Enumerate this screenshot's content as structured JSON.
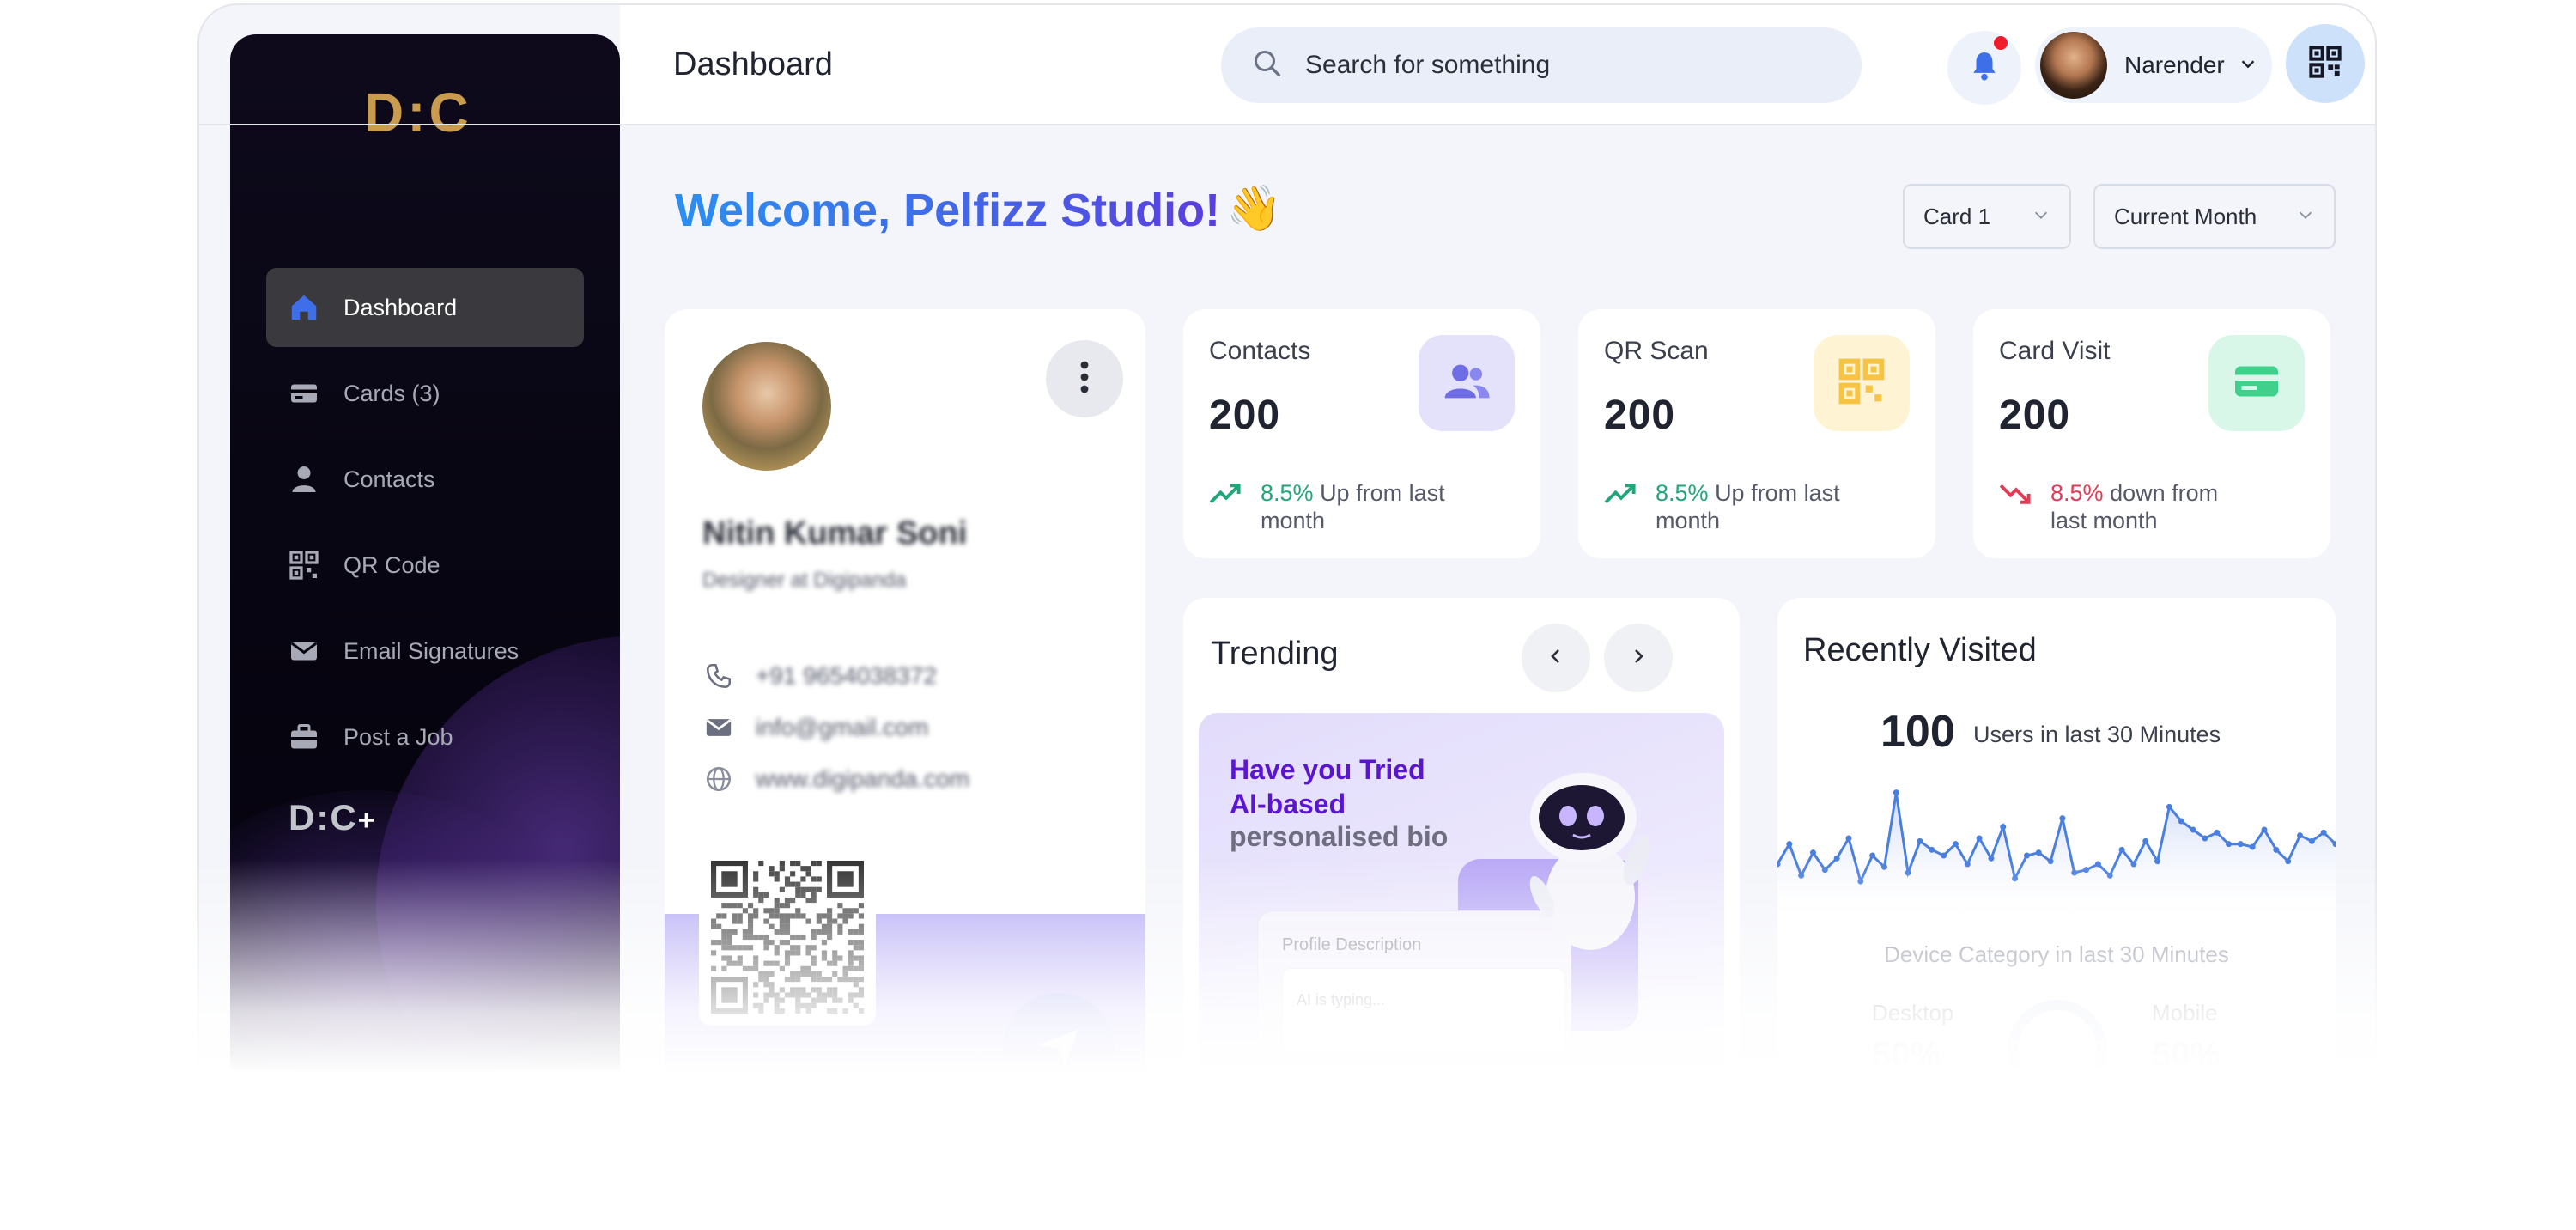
{
  "sidebar": {
    "logo": "D:C",
    "items": [
      {
        "label": "Dashboard",
        "icon": "home-icon",
        "active": true
      },
      {
        "label": "Cards (3)",
        "icon": "card-icon"
      },
      {
        "label": "Contacts",
        "icon": "person-icon"
      },
      {
        "label": "QR Code",
        "icon": "qr-icon"
      },
      {
        "label": "Email Signatures",
        "icon": "mail-icon"
      },
      {
        "label": "Post a Job",
        "icon": "briefcase-icon"
      }
    ],
    "footer_logo": "D:C"
  },
  "header": {
    "title": "Dashboard",
    "search_placeholder": "Search for something",
    "user_name": "Narender"
  },
  "welcome": {
    "text": "Welcome, Pelfizz Studio!",
    "emoji": "👋"
  },
  "filters": {
    "card": "Card 1",
    "period": "Current Month"
  },
  "profile": {
    "name": "Nitin Kumar Soni",
    "role": "Designer at Digipanda",
    "phone": "+91 9654038372",
    "email": "info@gmail.com",
    "website": "www.digipanda.com"
  },
  "stats": [
    {
      "label": "Contacts",
      "value": "200",
      "change": "8.5%",
      "direction": "up",
      "note": "Up from last month",
      "icon": "people-icon",
      "bg": "#e4e1fb",
      "color": "#6f6de6"
    },
    {
      "label": "QR Scan",
      "value": "200",
      "change": "8.5%",
      "direction": "up",
      "note": "Up from last month",
      "icon": "qr-icon",
      "bg": "#fef3d3",
      "color": "#f6c344"
    },
    {
      "label": "Card Visit",
      "value": "200",
      "change": "8.5%",
      "direction": "down",
      "note": "down from last month",
      "icon": "card-icon",
      "bg": "#d9f7e8",
      "color": "#3fd18c"
    }
  ],
  "trending": {
    "title": "Trending",
    "promo_line1": "Have you Tried",
    "promo_line2": "AI-based",
    "promo_line3": "personalised bio",
    "panel_label": "Profile Description",
    "panel_typing": "AI is typing..."
  },
  "recent": {
    "title": "Recently Visited",
    "count": "100",
    "count_label": "Users in last 30 Minutes",
    "series": [
      30,
      44,
      22,
      38,
      26,
      34,
      48,
      18,
      36,
      28,
      80,
      24,
      46,
      40,
      36,
      44,
      30,
      48,
      34,
      56,
      20,
      36,
      38,
      32,
      62,
      24,
      26,
      30,
      22,
      40,
      30,
      46,
      32,
      70,
      60,
      54,
      48,
      52,
      44,
      44,
      42,
      54,
      40,
      32,
      50,
      46,
      52,
      44
    ],
    "device_title": "Device Category in last 30 Minutes",
    "desktop_label": "Desktop",
    "desktop_value": "50%",
    "mobile_label": "Mobile",
    "mobile_value": "50%"
  }
}
